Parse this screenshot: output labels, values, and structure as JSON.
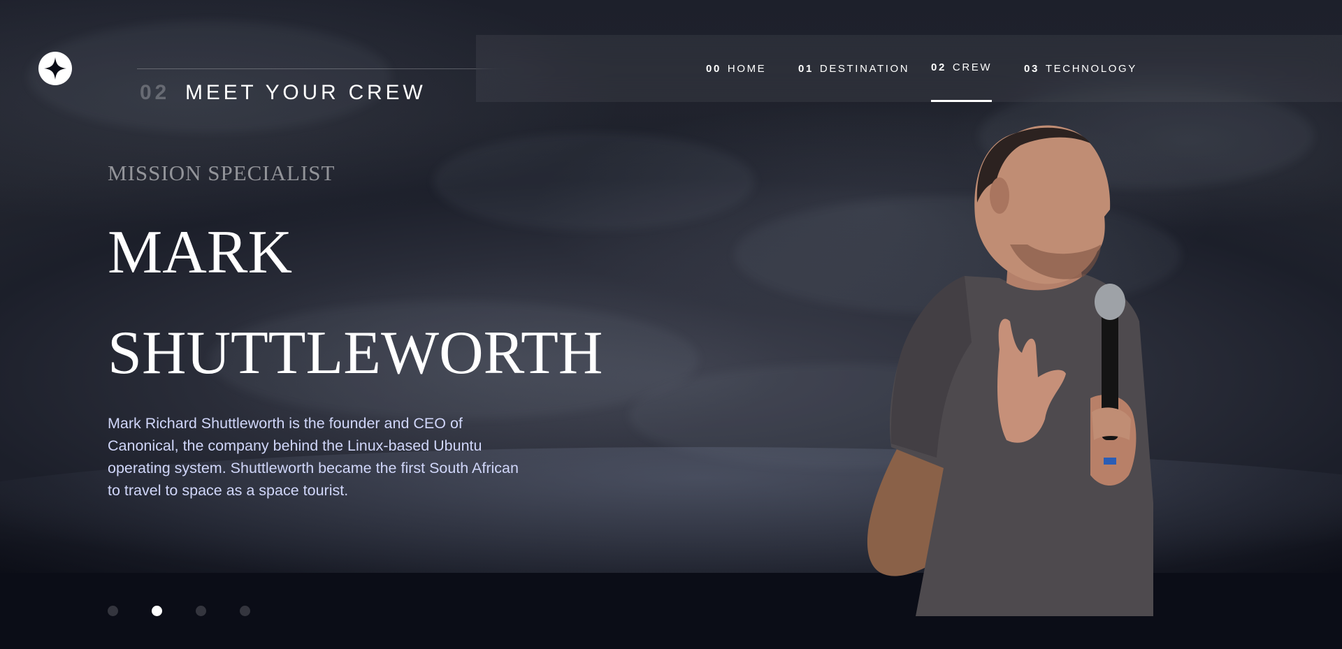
{
  "nav": {
    "items": [
      {
        "num": "00",
        "label": "Home"
      },
      {
        "num": "01",
        "label": "Destination"
      },
      {
        "num": "02",
        "label": "Crew"
      },
      {
        "num": "03",
        "label": "Technology"
      }
    ],
    "active_index": 2
  },
  "heading": {
    "num": "02",
    "text": "Meet your crew"
  },
  "crew": {
    "role": "Mission Specialist",
    "name_line1": "Mark",
    "name_line2": "Shuttleworth",
    "bio": "Mark Richard Shuttleworth is the founder and CEO of Canonical, the company behind the Linux-based Ubuntu operating system. Shuttleworth became the first South African to travel to space as a space tourist."
  },
  "pager": {
    "count": 4,
    "active_index": 1
  },
  "icons": {
    "logo": "star-logo-icon"
  },
  "colors": {
    "background": "#0b0d17",
    "text": "#ffffff",
    "bio_text": "#d0d6f9",
    "muted": "rgba(255,255,255,0.5)"
  }
}
